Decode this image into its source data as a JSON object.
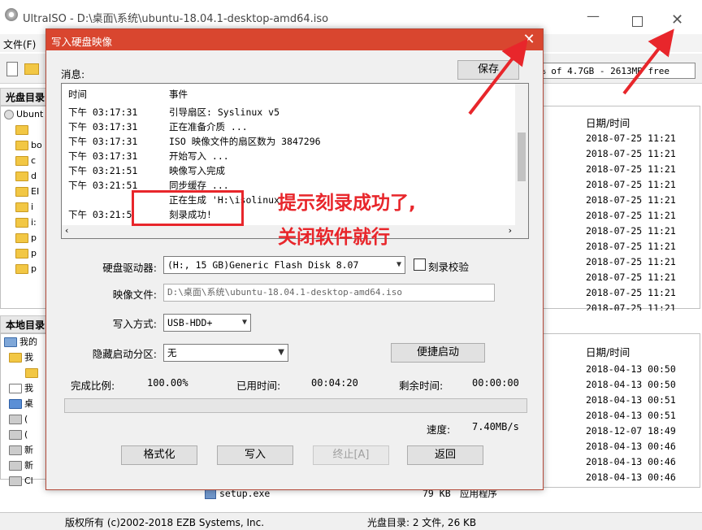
{
  "main_window": {
    "title": "UltraISO - D:\\桌面\\系统\\ubuntu-18.04.1-desktop-amd64.iso",
    "menu": [
      "文件(F)"
    ],
    "free_text": "% of 4.7GB - 2613MB free",
    "top_pane": {
      "header": "光盘目录",
      "tree": [
        "Ubunt",
        "bo",
        "c",
        "d",
        "EI",
        "i",
        "i:",
        "p",
        "p",
        "p"
      ],
      "date_header": "日期/时间",
      "dates": [
        "2018-07-25 11:21",
        "2018-07-25 11:21",
        "2018-07-25 11:21",
        "2018-07-25 11:21",
        "2018-07-25 11:21",
        "2018-07-25 11:21",
        "2018-07-25 11:21",
        "2018-07-25 11:21",
        "2018-07-25 11:21",
        "2018-07-25 11:21",
        "2018-07-25 11:21",
        "2018-07-25 11:21"
      ]
    },
    "bottom_pane": {
      "header": "本地目录",
      "tree": [
        "我的",
        "我",
        "我",
        "桌",
        "(",
        "(",
        "新",
        "新",
        "Cl"
      ],
      "date_header": "日期/时间",
      "dates": [
        "2018-04-13 00:50",
        "2018-04-13 00:50",
        "2018-04-13 00:51",
        "2018-04-13 00:51",
        "2018-12-07 18:49",
        "2018-04-13 00:46",
        "2018-04-13 00:46",
        "2018-04-13 00:46"
      ],
      "file_row": {
        "name": "setup.exe",
        "size": "79 KB",
        "type": "应用程序"
      }
    },
    "status": {
      "copyright": "版权所有 (c)2002-2018 EZB Systems, Inc.",
      "disc": "光盘目录: 2 文件, 26 KB"
    }
  },
  "dialog": {
    "title": "写入硬盘映像",
    "close_glyph": "✕",
    "messages_label": "消息:",
    "save_label": "保存",
    "log_headers": {
      "time": "时间",
      "event": "事件"
    },
    "log": [
      {
        "time": "下午 03:17:31",
        "event": "引导扇区: Syslinux v5"
      },
      {
        "time": "下午 03:17:31",
        "event": "正在准备介质 ..."
      },
      {
        "time": "下午 03:17:31",
        "event": "ISO 映像文件的扇区数为 3847296"
      },
      {
        "time": "下午 03:17:31",
        "event": "开始写入 ..."
      },
      {
        "time": "下午 03:21:51",
        "event": "映像写入完成"
      },
      {
        "time": "下午 03:21:51",
        "event": "同步缓存 ..."
      },
      {
        "time": "",
        "event": "正在生成 'H:\\isolinux..."
      },
      {
        "time": "下午 03:21:5",
        "event": "刻录成功!"
      }
    ],
    "drive_label": "硬盘驱动器:",
    "drive_value": "(H:, 15 GB)Generic Flash Disk     8.07",
    "verify_label": "刻录校验",
    "image_label": "映像文件:",
    "image_value": "D:\\桌面\\系统\\ubuntu-18.04.1-desktop-amd64.iso",
    "write_mode_label": "写入方式:",
    "write_mode_value": "USB-HDD+",
    "hidden_label": "隐藏启动分区:",
    "hidden_value": "无",
    "quick_boot_label": "便捷启动",
    "progress": {
      "done_label": "完成比例:",
      "done_value": "100.00%",
      "elapsed_label": "已用时间:",
      "elapsed_value": "00:04:20",
      "remaining_label": "剩余时间:",
      "remaining_value": "00:00:00",
      "fraction": 1.0,
      "speed_label": "速度:",
      "speed_value": "7.40MB/s"
    },
    "buttons": {
      "format": "格式化",
      "write": "写入",
      "stop": "终止[A]",
      "back": "返回"
    }
  },
  "annotation": {
    "line1": "提示刻录成功了,",
    "line2": "关闭软件就行",
    "color": "#e8262b"
  }
}
